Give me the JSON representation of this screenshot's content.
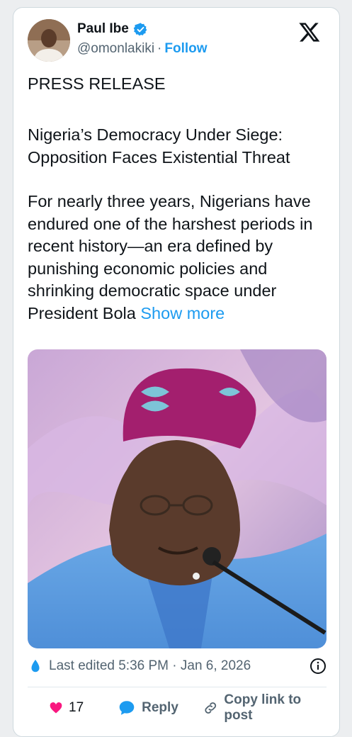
{
  "post": {
    "author_name": "Paul Ibe",
    "author_handle": "@omonlakiki",
    "separator": "·",
    "follow_label": "Follow",
    "paragraphs": {
      "p1": "PRESS RELEASE",
      "p2": "Nigeria’s Democracy Under Siege: Opposition Faces Existential Threat",
      "p3": "For nearly three years, Nigerians have endured one of the harshest periods in recent history—an era defined by punishing economic policies and shrinking democratic space under President Bola"
    },
    "show_more_label": "Show more",
    "edited_text": "Last edited 5:36 PM · Jan 6, 2026",
    "like_count": "17",
    "reply_label": "Reply",
    "copy_link_label": "Copy link to post"
  },
  "colors": {
    "accent": "#1d9bf0",
    "like_red": "#f91880",
    "text_primary": "#0f1419",
    "text_secondary": "#536471"
  }
}
